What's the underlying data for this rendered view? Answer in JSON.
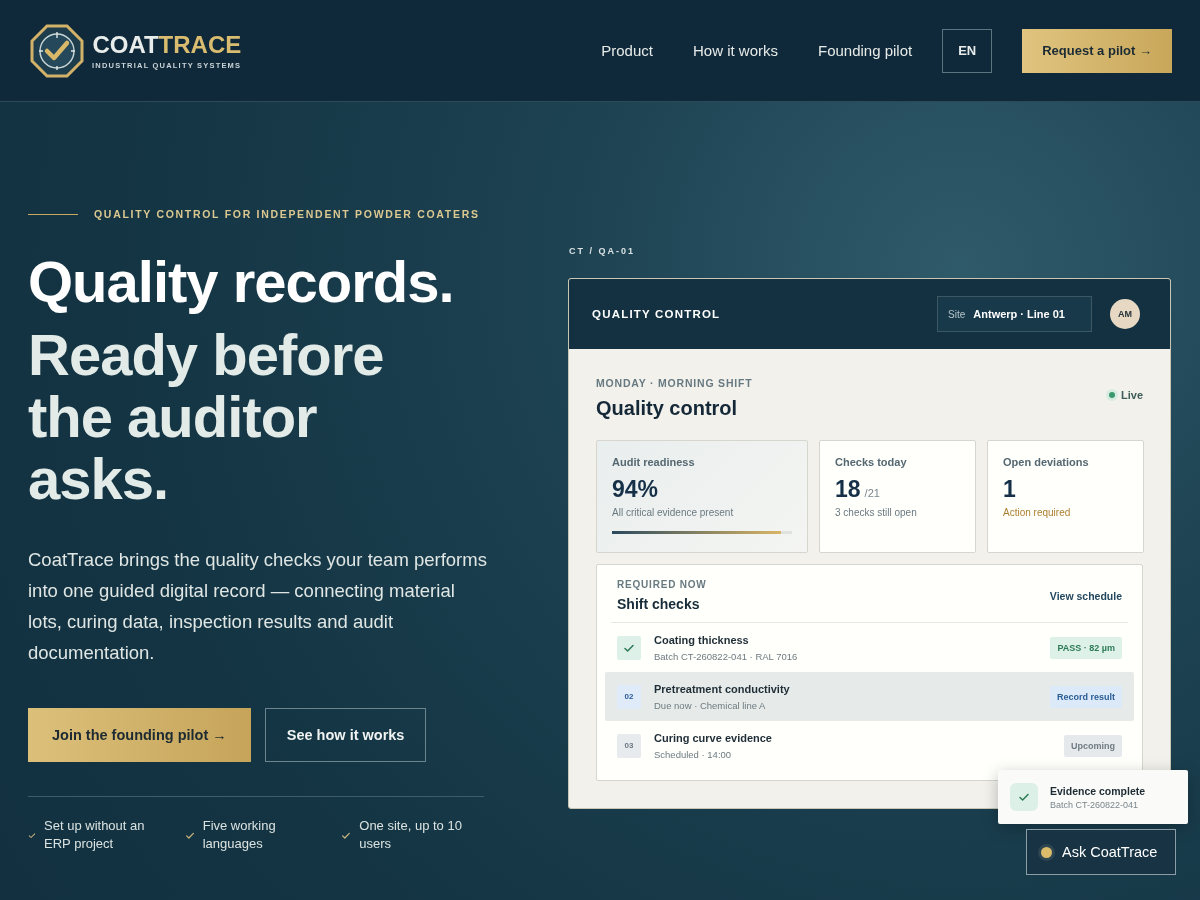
{
  "header": {
    "brand_primary": "COAT",
    "brand_accent": "TRACE",
    "tagline": "INDUSTRIAL QUALITY SYSTEMS",
    "nav": [
      "Product",
      "How it works",
      "Founding pilot"
    ],
    "language": "EN",
    "cta": "Request a pilot →"
  },
  "hero": {
    "eyebrow": "QUALITY CONTROL FOR INDEPENDENT POWDER COATERS",
    "headline": "Quality records.",
    "subheadline": "Ready before the auditor asks.",
    "description": "CoatTrace brings the quality checks your team performs into one guided digital record — connecting material lots, curing data, inspection results and audit documentation.",
    "primary_button": "Join the founding pilot →",
    "secondary_button": "See how it works",
    "features": [
      "Set up without an ERP project",
      "Five working languages",
      "One site, up to 10 users"
    ]
  },
  "dashboard": {
    "code": "CT / QA-01",
    "title": "QUALITY CONTROL",
    "site_label": "Site",
    "site_value": "Antwerp · Line 01",
    "avatar": "AM",
    "shift": "MONDAY · MORNING SHIFT",
    "heading": "Quality control",
    "status": "Live",
    "stats": [
      {
        "kind": "progress",
        "label": "Audit readiness",
        "value": "94%",
        "note": "All critical evidence present",
        "level": 0.94
      },
      {
        "kind": "count",
        "label": "Checks today",
        "value": "18",
        "unit": "/21",
        "note": "3 checks still open"
      },
      {
        "kind": "alert",
        "label": "Open deviations",
        "value": "1",
        "note": "Action required"
      }
    ],
    "checks": {
      "eyebrow": "REQUIRED NOW",
      "title": "Shift checks",
      "link": "View schedule",
      "items": [
        {
          "kind": "done",
          "title": "Coating thickness",
          "detail": "Batch CT-260822-041 · RAL 7016",
          "badge": "PASS · 82 µm",
          "selected": false
        },
        {
          "kind": "due",
          "number": "02",
          "title": "Pretreatment conductivity",
          "detail": "Due now · Chemical line A",
          "badge": "Record result",
          "selected": true
        },
        {
          "kind": "upcoming",
          "number": "03",
          "title": "Curing curve evidence",
          "detail": "Scheduled · 14:00",
          "badge": "Upcoming",
          "selected": false
        }
      ]
    }
  },
  "toast": {
    "title": "Evidence complete",
    "detail": "Batch CT-260822-041"
  },
  "assistant_button": "Ask CoatTrace"
}
